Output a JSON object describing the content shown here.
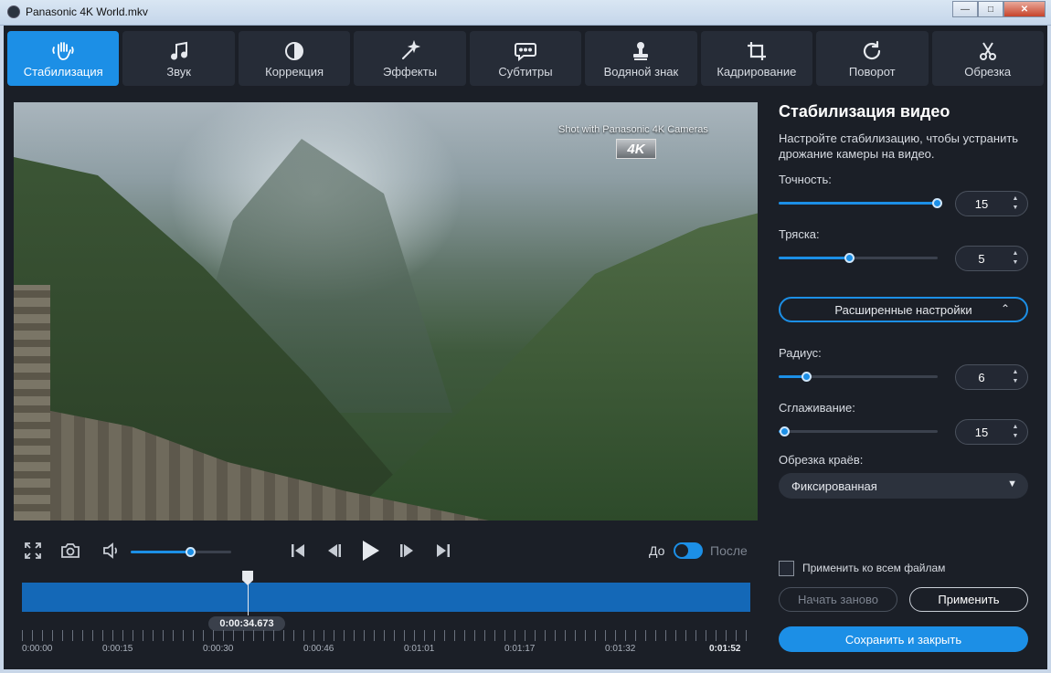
{
  "window": {
    "title": "Panasonic 4K World.mkv"
  },
  "tabs": [
    {
      "label": "Стабилизация",
      "icon": "hand-icon",
      "active": true
    },
    {
      "label": "Звук",
      "icon": "music-note-icon",
      "active": false
    },
    {
      "label": "Коррекция",
      "icon": "contrast-icon",
      "active": false
    },
    {
      "label": "Эффекты",
      "icon": "magic-wand-icon",
      "active": false
    },
    {
      "label": "Субтитры",
      "icon": "speech-bubble-icon",
      "active": false
    },
    {
      "label": "Водяной знак",
      "icon": "stamp-icon",
      "active": false
    },
    {
      "label": "Кадрирование",
      "icon": "crop-icon",
      "active": false
    },
    {
      "label": "Поворот",
      "icon": "rotate-icon",
      "active": false
    },
    {
      "label": "Обрезка",
      "icon": "scissors-icon",
      "active": false
    }
  ],
  "video": {
    "overlay_text": "Shot with Panasonic 4K Cameras",
    "badge": "4K"
  },
  "playback": {
    "volume_level": 0.6,
    "before_label": "До",
    "after_label": "После",
    "current_time": "0:00:34.673",
    "position_fraction": 0.31
  },
  "timeline": {
    "labels": [
      "0:00:00",
      "0:00:15",
      "0:00:30",
      "0:00:46",
      "0:01:01",
      "0:01:17",
      "0:01:32",
      "0:01:52"
    ]
  },
  "panel": {
    "heading": "Стабилизация видео",
    "description": "Настройте стабилизацию, чтобы устранить дрожание камеры на видео.",
    "accuracy": {
      "label": "Точность:",
      "value": "15",
      "fraction": 1.0
    },
    "shake": {
      "label": "Тряска:",
      "value": "5",
      "fraction": 0.45
    },
    "advanced_button": "Расширенные настройки",
    "radius": {
      "label": "Радиус:",
      "value": "6",
      "fraction": 0.18
    },
    "smoothing": {
      "label": "Сглаживание:",
      "value": "15",
      "fraction": 0.04
    },
    "edge_crop": {
      "label": "Обрезка краёв:",
      "value": "Фиксированная"
    },
    "apply_all_label": "Применить ко всем файлам",
    "reset_button": "Начать заново",
    "apply_button": "Применить",
    "save_button": "Сохранить и закрыть"
  },
  "colors": {
    "accent": "#1c8fe6",
    "background": "#1b1f27",
    "tab_bg": "#262c37",
    "timeline": "#1468b7"
  }
}
